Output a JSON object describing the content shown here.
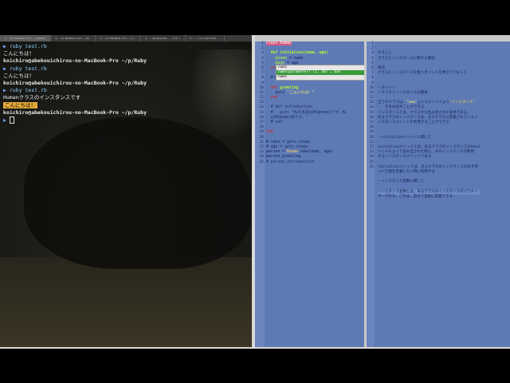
{
  "tabs": [
    "1. …ho-MacBook-Pro: ~/p/Ruby",
    "2. …ho-MacBook-Pro: ~/d…",
    "3. …ho-MacBook-Pro: ~/c…",
    "4. … Apache/Pac... 2.0 …",
    "5. … ~/src/ShiftIt …"
  ],
  "terminal": {
    "prompt_symbol": "▶",
    "host": "koichiro@abekouichirou-no-MacBook-Pro ~/p/Ruby",
    "command": "ruby test.rb",
    "greeting": "こんにちは！",
    "class_msg": "Humanクラスのインスタンスです"
  },
  "editor": {
    "line_numbers": [
      "1",
      "2",
      "3",
      "4",
      "5",
      "6",
      "7",
      "8",
      "9",
      "10",
      "11",
      "12",
      "13",
      "14",
      "15",
      "16",
      "17",
      "18",
      "19",
      "20",
      "21",
      "22",
      "23",
      "24",
      "25"
    ],
    "l1": "class Human",
    "l3": "def initialize(name, age)",
    "l4a": "@name",
    "l4b": " = name",
    "l5a": "@age",
    "l5b": " = age",
    "l6": "end",
    "l8": "#インスタンスメソッド",
    "l10a": "def ",
    "l10b": "greeting",
    "l11a": "puts ",
    "l11b": "\"こんにちは！\"",
    "l12": "end",
    "l14": "# def introduction",
    "l15": "#   puts \"私の名前は#{@name}です。私",
    "l15b": "は#{@age}歳です。\"",
    "l16": "# end",
    "l18": "end",
    "l20": "# name = gets.chomp",
    "l21": "# age = gets.chomp",
    "l22a": "person = ",
    "l22b": "Human",
    "l22c": ".new(name, age)",
    "l23": "person.greeting",
    "l24": "# person.introduction",
    "popup_item1": "name",
    "popup_item2": "name(parameter) (1, 38) … bas",
    "popup_item3": "name"
  },
  "notes": {
    "line_numbers": [
      "1",
      "2",
      "3",
      "4",
      "5",
      "6",
      "7",
      "8",
      "9",
      "10",
      "11",
      "12",
      "13",
      "14",
      "15",
      "16",
      "17",
      "18",
      "19",
      "20",
      "21",
      "22",
      "23",
      "24",
      "25",
      "26"
    ],
    "n3": "やること",
    "n4": "クラスとインスタンスに関する解説",
    "n6": "目的",
    "n7": "クラスとインスタンスを扱うポイントを押さえてもらう",
    "n10": "・ポイント",
    "n11": "・クラスとインスタンスの関係",
    "n13a": "全てのクラスは、",
    "n13b": "\"new\"",
    "n13c": "というメソッドより",
    "n13d": "\"インスタンス\"",
    "n13e": "　　を生み出すことができる",
    "n14": "インスタンスとは、クラスから生み出された実体である。",
    "n15a": "あるクラスのインスタンスは、そのクラスに定義されているイ",
    "n15b": "ンスタンスメソッドを利用することができる",
    "n19": "・initializeメソッドに関して",
    "n21a": "initializeメソッドとは、あるクラスのインスタンスがnewメ",
    "n21b": "ソッドによって生み出された時に、そのインスタンスが利用",
    "n21c": "するインスタンスメソッドである",
    "n22a": "initializeメソッドは、あるクラスのインスタンスが必ず持",
    "n22b": "っべき値を定義したい時に利用する",
    "n24": "・インスタンス変数に関して",
    "n26a": "インスタンス変数とは、あるクラスのインスタンスのパラメー",
    "n26b": "ターである。これは、自分で自由に定義できる"
  }
}
